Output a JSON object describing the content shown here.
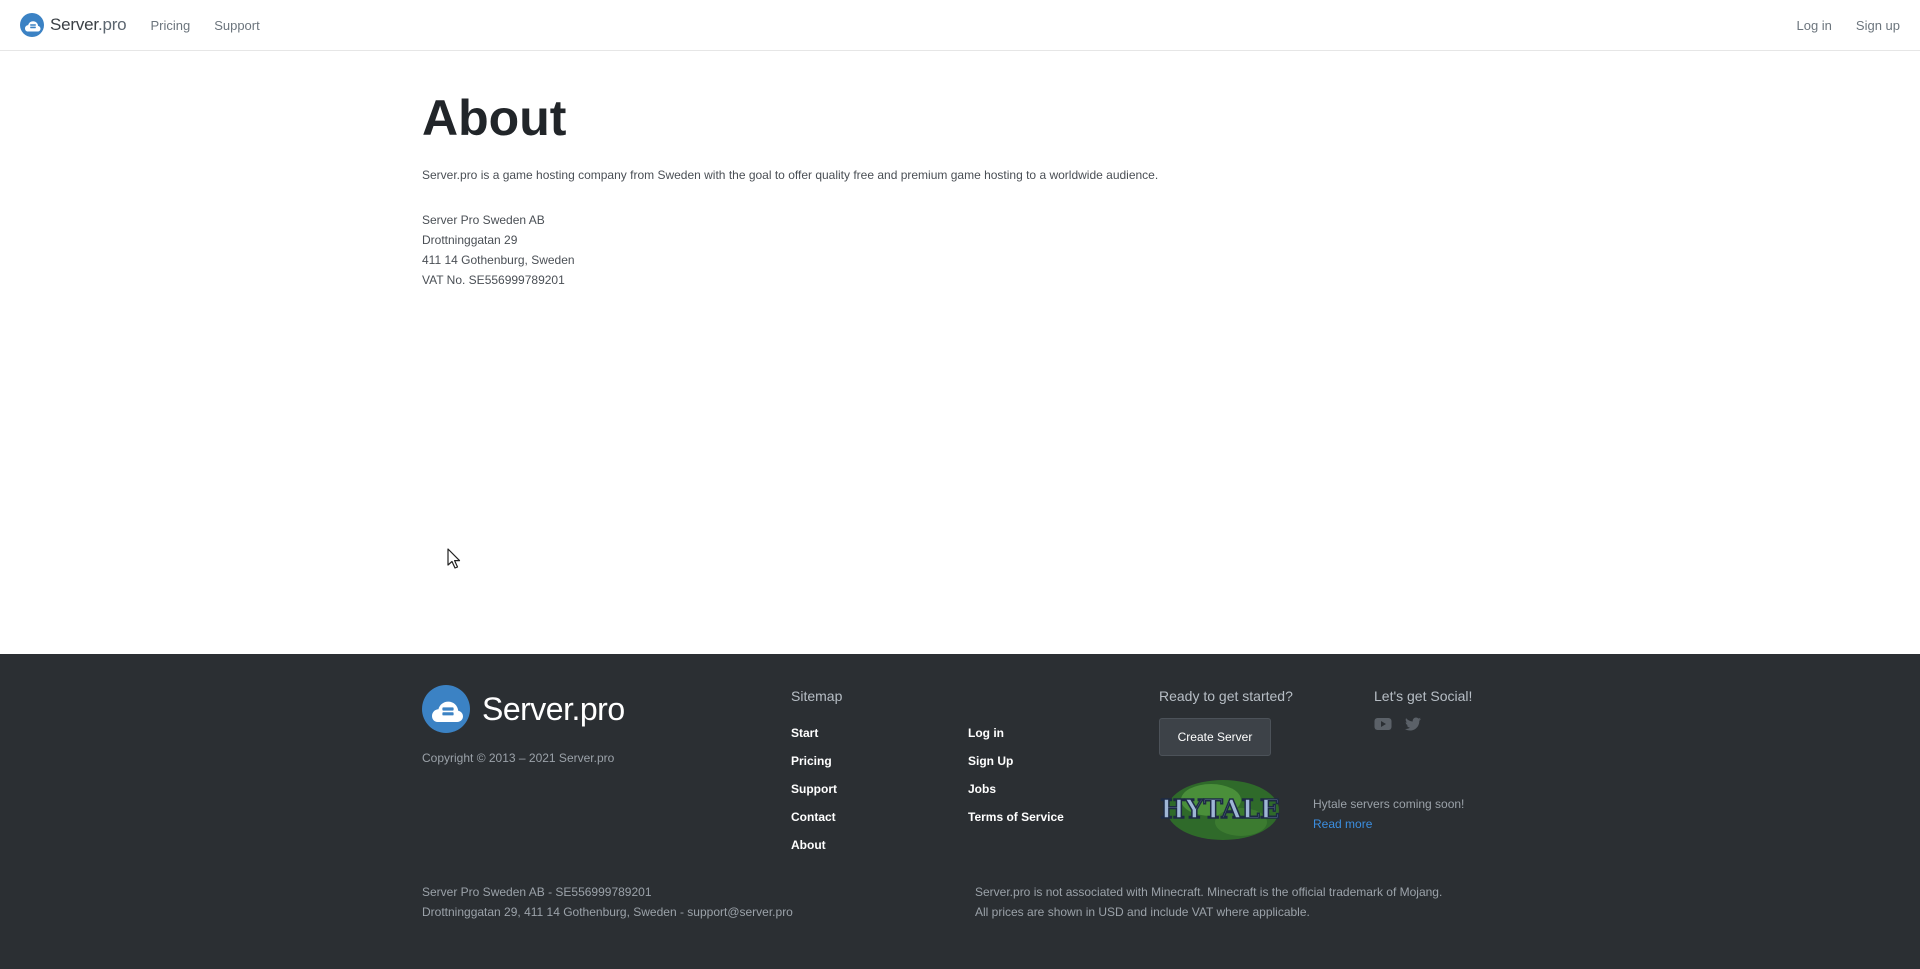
{
  "navbar": {
    "brand_main": "Server",
    "brand_suffix": ".pro",
    "links": [
      "Pricing",
      "Support"
    ],
    "login": "Log in",
    "signup": "Sign up"
  },
  "main": {
    "title": "About",
    "intro": "Server.pro is a game hosting company from Sweden with the goal to offer quality free and premium game hosting to a worldwide audience.",
    "address": [
      "Server Pro Sweden AB",
      "Drottninggatan 29",
      "411 14 Gothenburg, Sweden",
      "VAT No. SE556999789201"
    ]
  },
  "footer": {
    "brand_main": "Server",
    "brand_suffix": ".pro",
    "copyright": "Copyright © 2013 – 2021 Server.pro",
    "sitemap_title": "Sitemap",
    "sitemap_col1": [
      "Start",
      "Pricing",
      "Support",
      "Contact",
      "About"
    ],
    "sitemap_col2": [
      "Log in",
      "Sign Up",
      "Jobs",
      "Terms of Service"
    ],
    "ready_title": "Ready to get started?",
    "create_server": "Create Server",
    "social_title": "Let's get Social!",
    "social_icons": [
      "youtube-icon",
      "twitter-icon"
    ],
    "hytale_logo_text": "HYTALE",
    "hytale_text": "Hytale servers coming soon!",
    "read_more": "Read more",
    "company_line1": "Server Pro Sweden AB - SE556999789201",
    "company_line2": "Drottninggatan 29, 411 14 Gothenburg, Sweden - support@server.pro",
    "disclaimer_line1": "Server.pro is not associated with Minecraft. Minecraft is the official trademark of Mojang.",
    "disclaimer_line2": "All prices are shown in USD and include VAT where applicable."
  },
  "colors": {
    "footer_bg": "#2b2f33",
    "brand_blue": "#3b82c4",
    "link_blue": "#3b8ee0"
  }
}
